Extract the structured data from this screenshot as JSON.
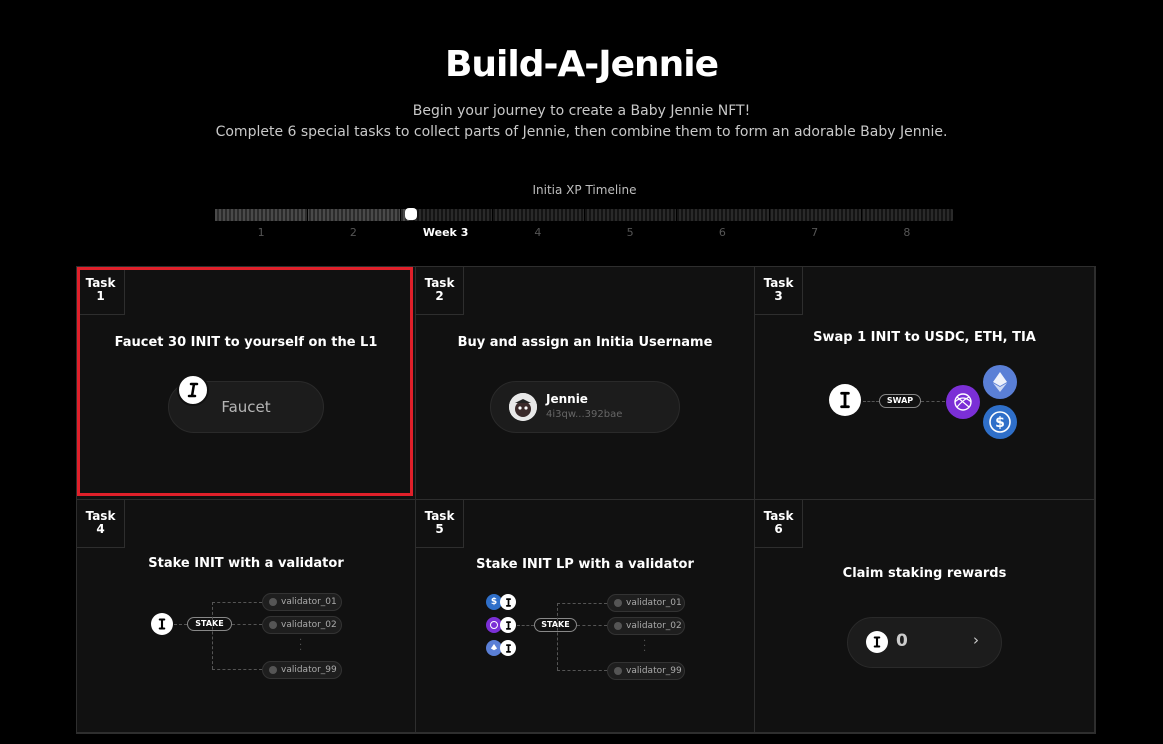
{
  "header": {
    "title": "Build-A-Jennie",
    "subtitle_line1": "Begin your journey to create a Baby Jennie NFT!",
    "subtitle_line2": "Complete 6 special tasks to collect parts of Jennie, then combine them to form an adorable Baby Jennie."
  },
  "timeline": {
    "label": "Initia XP Timeline",
    "progress": 0.265,
    "weeks": [
      "1",
      "2",
      "Week 3",
      "4",
      "5",
      "6",
      "7",
      "8"
    ],
    "active_week": 3
  },
  "tasks": [
    {
      "tag_word": "Task",
      "tag_num": "1",
      "title": "Faucet 30 INIT to yourself on the L1",
      "button": "Faucet"
    },
    {
      "tag_word": "Task",
      "tag_num": "2",
      "title": "Buy and assign an Initia Username",
      "username": "Jennie",
      "address": "4i3qw...392bae"
    },
    {
      "tag_word": "Task",
      "tag_num": "3",
      "title": "Swap 1 INIT to USDC, ETH, TIA",
      "badge": "SWAP"
    },
    {
      "tag_word": "Task",
      "tag_num": "4",
      "title": "Stake INIT with a validator",
      "badge": "STAKE",
      "validators": [
        "validator_01",
        "validator_02",
        "validator_99"
      ]
    },
    {
      "tag_word": "Task",
      "tag_num": "5",
      "title": "Stake INIT LP with a validator",
      "badge": "STAKE",
      "validators": [
        "validator_01",
        "validator_02",
        "validator_99"
      ]
    },
    {
      "tag_word": "Task",
      "tag_num": "6",
      "title": "Claim staking rewards",
      "amount": "0",
      "chevron": "›"
    }
  ],
  "icons": {
    "init": "init-bone-icon",
    "usdc": "usdc-icon",
    "eth": "eth-icon",
    "tia": "tia-icon"
  },
  "colors": {
    "highlight": "#e0202a",
    "background": "#000000",
    "card": "#111111",
    "tia": "#7b2fd6",
    "eth": "#5a7fd6",
    "usdc": "#2f6fc9"
  }
}
